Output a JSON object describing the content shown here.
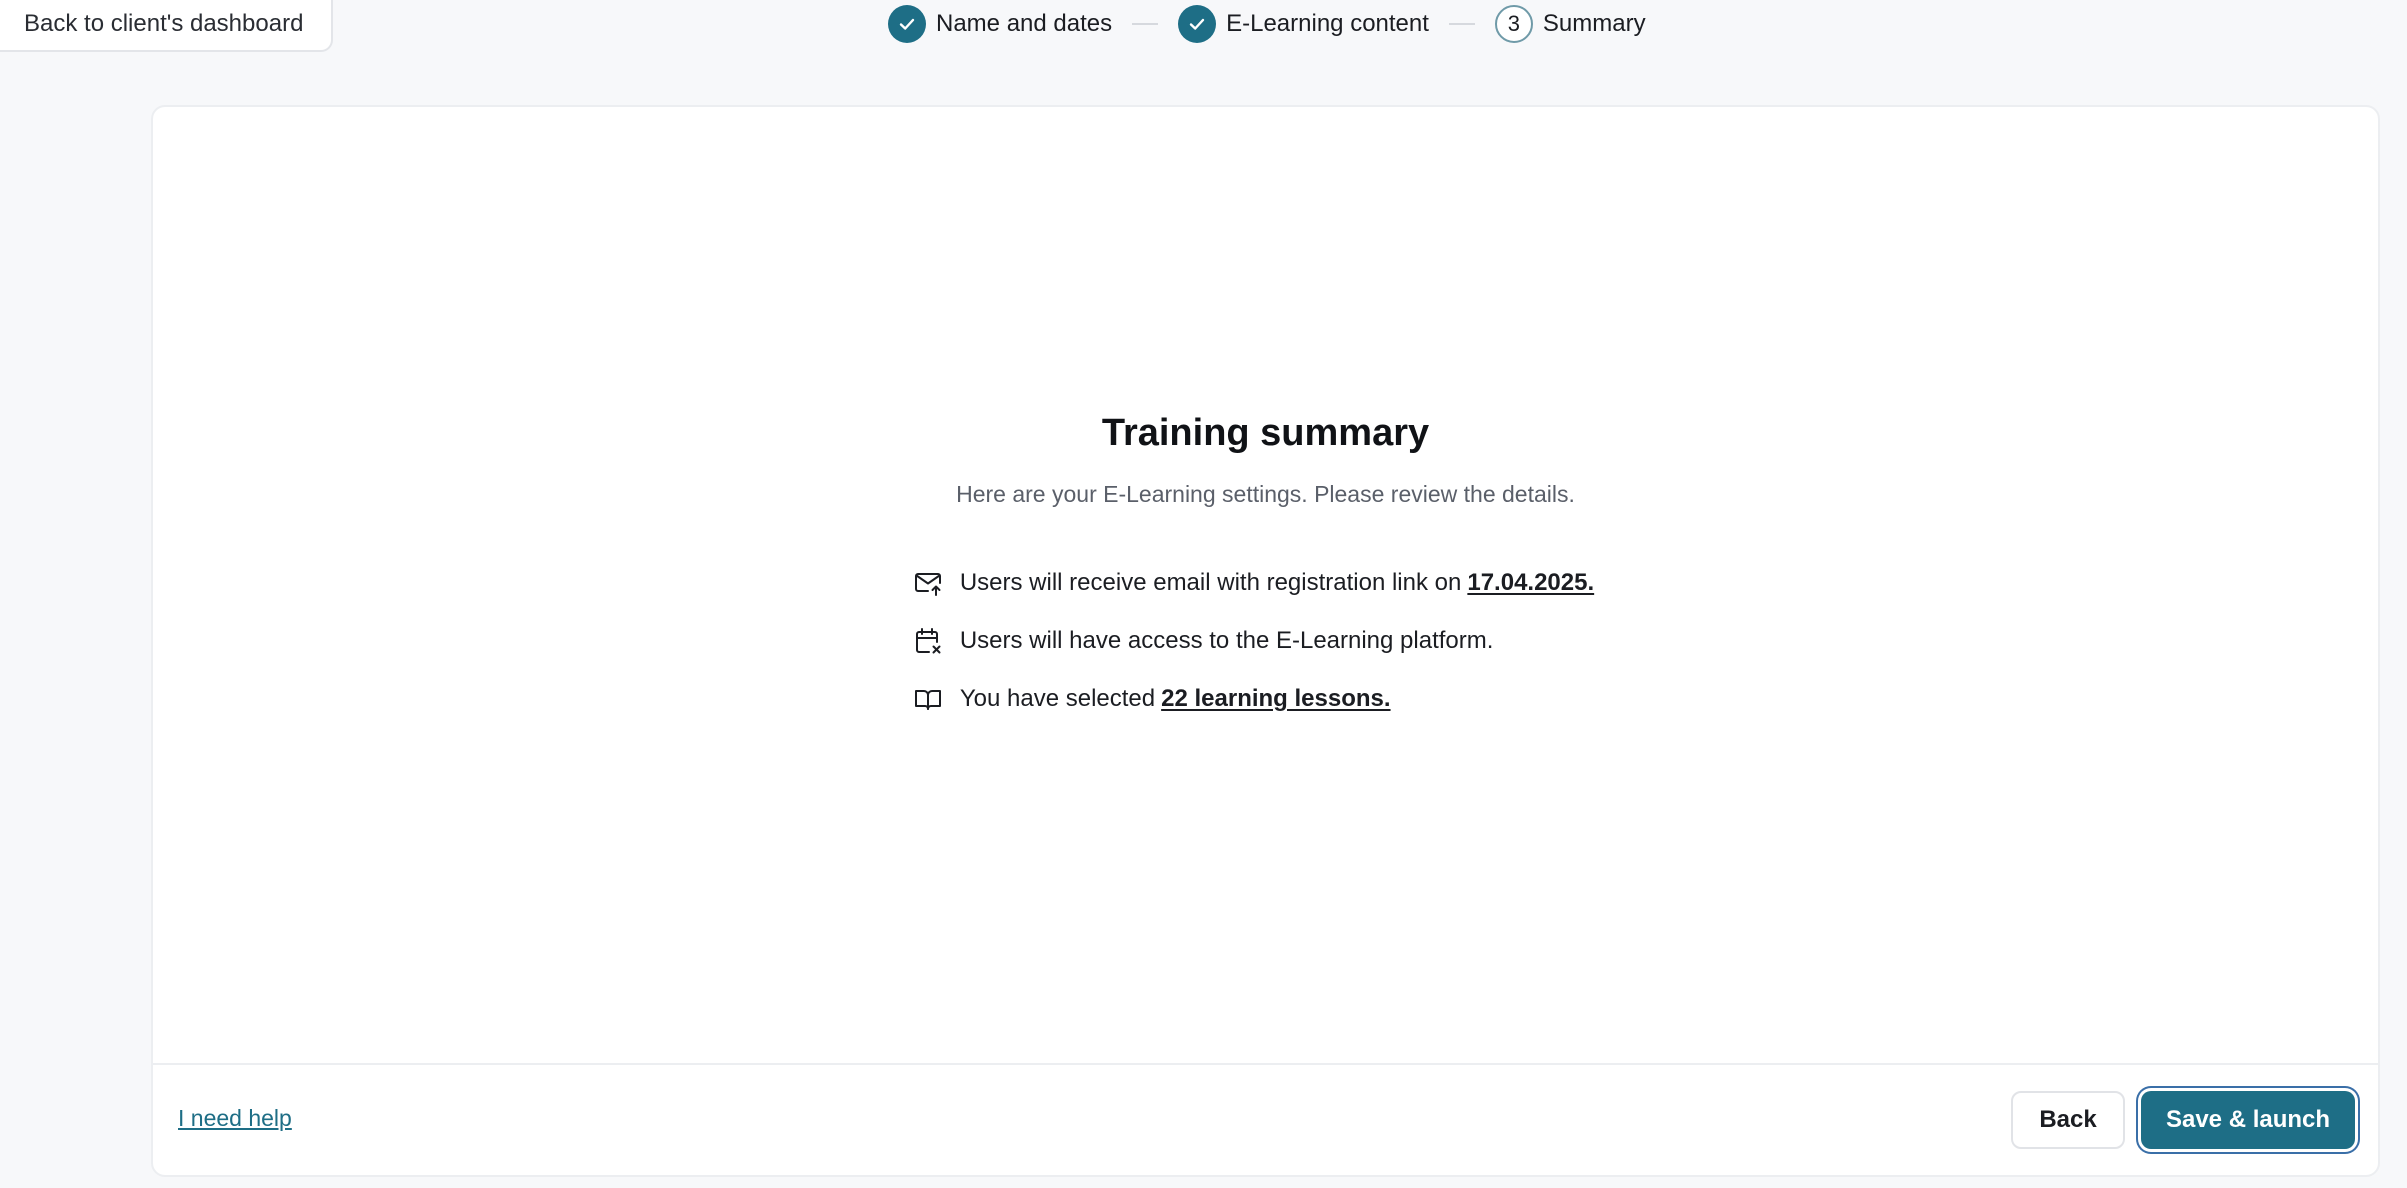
{
  "header": {
    "back_label": "Back to client's dashboard",
    "steps": [
      {
        "label": "Name and dates",
        "state": "done"
      },
      {
        "label": "E-Learning content",
        "state": "done"
      },
      {
        "label": "Summary",
        "state": "current",
        "number": "3"
      }
    ]
  },
  "summary": {
    "title": "Training summary",
    "subtitle": "Here are your E-Learning settings. Please review the details.",
    "items": [
      {
        "icon": "mail-upload-icon",
        "text": "Users will receive email with registration link on ",
        "emphasis": "17.04.2025."
      },
      {
        "icon": "calendar-x-icon",
        "text": "Users will have access to the E-Learning platform.",
        "emphasis": ""
      },
      {
        "icon": "book-open-icon",
        "text": "You have selected ",
        "emphasis": "22 learning lessons."
      }
    ]
  },
  "footer": {
    "help_label": "I need help",
    "back_label": "Back",
    "save_label": "Save & launch"
  },
  "colors": {
    "accent": "#1e6e86",
    "background": "#f7f8fa"
  }
}
